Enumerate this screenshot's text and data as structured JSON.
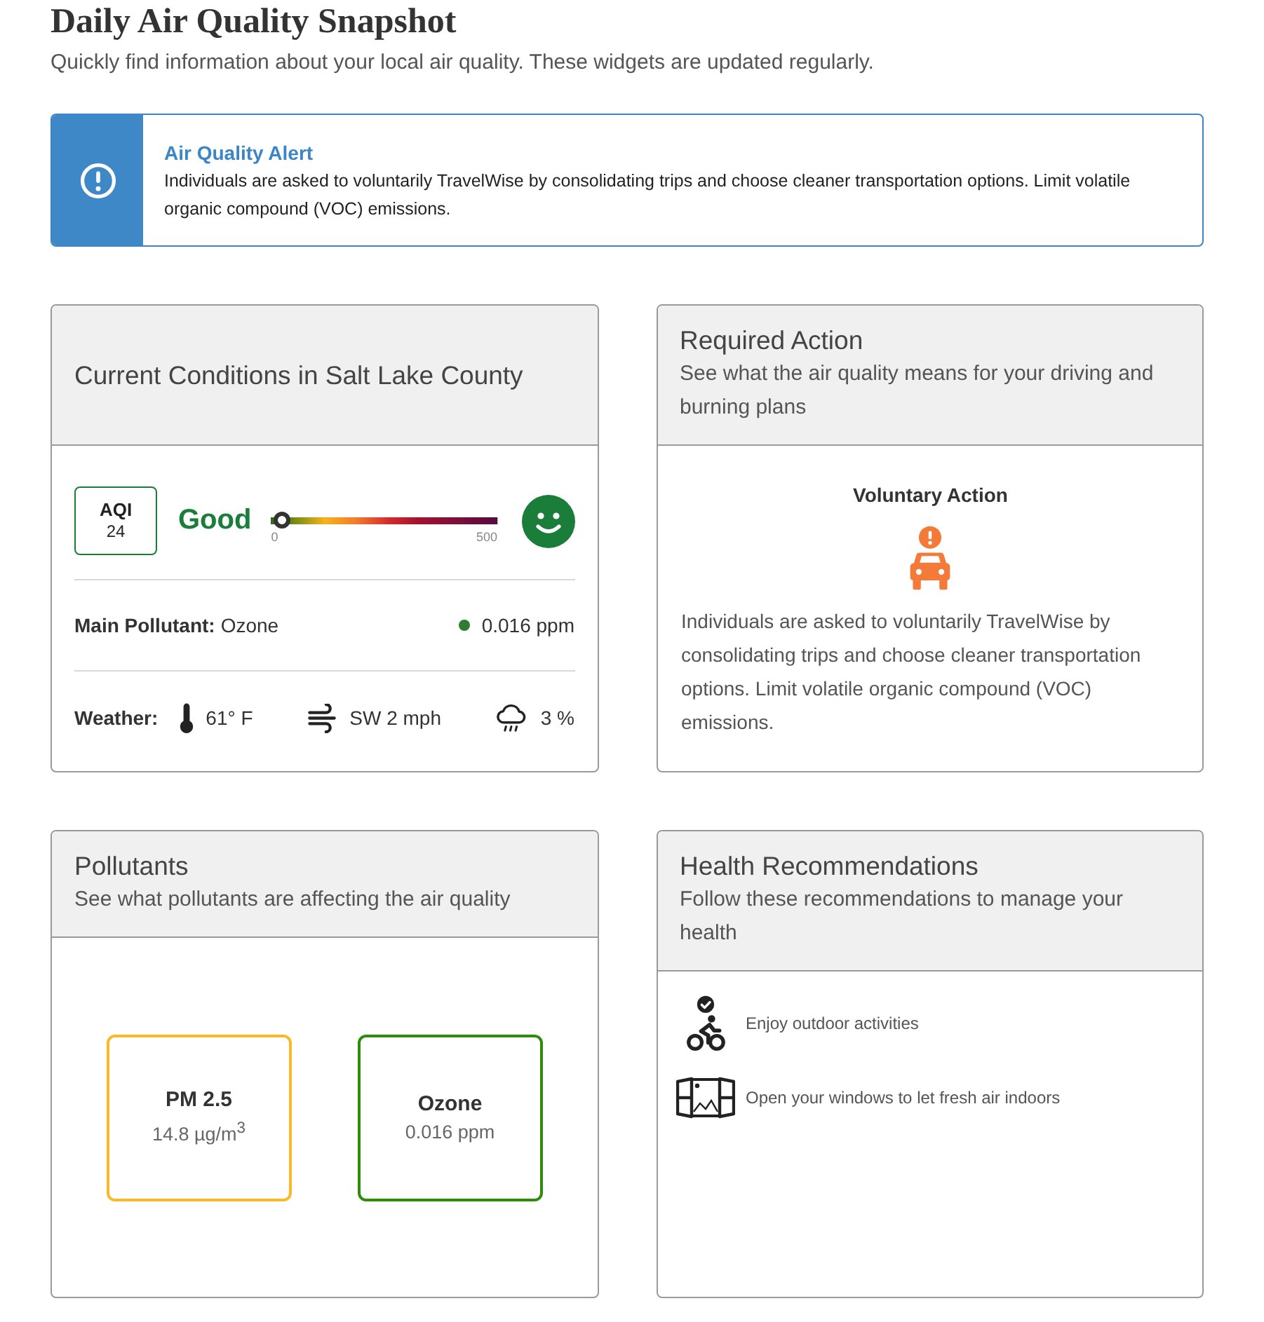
{
  "page": {
    "title": "Daily Air Quality Snapshot",
    "subtitle": "Quickly find information about your local air quality. These widgets are updated regularly."
  },
  "alert": {
    "title": "Air Quality Alert",
    "message": "Individuals are asked to voluntarily TravelWise by consolidating trips and choose cleaner transportation options. Limit volatile organic compound (VOC) emissions."
  },
  "current_conditions": {
    "title": "Current Conditions in Salt Lake County",
    "aqi": {
      "label": "AQI",
      "value": "24",
      "category": "Good",
      "color": "#1b7d3a"
    },
    "scale": {
      "level": 0.048,
      "min_label": "0",
      "max_label": "500"
    },
    "main_pollutant": {
      "label": "Main Pollutant:",
      "value": "Ozone",
      "reading": "0.016 ppm",
      "color": "#2e7d32"
    },
    "weather": {
      "label": "Weather:",
      "items": [
        {
          "kind": "temperature",
          "value": "61° F"
        },
        {
          "kind": "wind",
          "value": "SW 2 mph"
        },
        {
          "kind": "precipitation",
          "value": "3 %"
        }
      ]
    }
  },
  "required_action": {
    "title": "Required Action",
    "subtitle": "See what the air quality means for your driving and burning plans",
    "action": {
      "title": "Voluntary Action",
      "description": "Individuals are asked to voluntarily TravelWise by consolidating trips and choose cleaner transportation options. Limit volatile organic compound (VOC) emissions."
    }
  },
  "pollutants": {
    "title": "Pollutants",
    "subtitle": "See what pollutants are affecting the air quality",
    "items": [
      {
        "name": "PM 2.5",
        "reading": "14.8 µg/m$^{3}$",
        "color": "#fbb829"
      },
      {
        "name": "Ozone",
        "reading": "0.016 ppm",
        "color": "#2e8b0b"
      }
    ]
  },
  "health": {
    "title": "Health Recommendations",
    "subtitle": "Follow these recommendations to manage your health",
    "items": [
      {
        "kind": "cycling",
        "text": "Enjoy outdoor activities"
      },
      {
        "kind": "window",
        "text": "Open your windows to let fresh air indoors"
      }
    ]
  }
}
